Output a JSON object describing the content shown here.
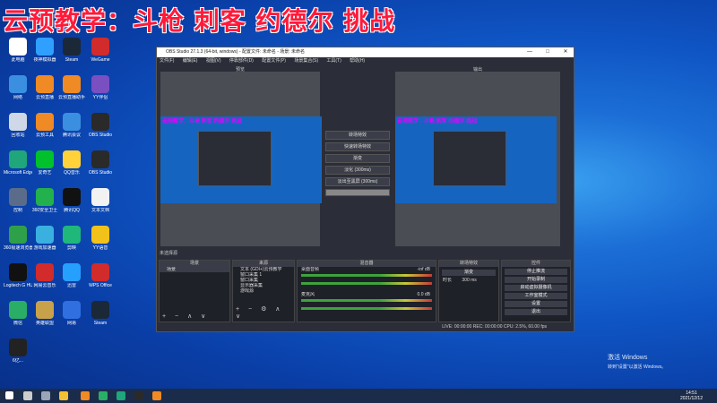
{
  "overlay": {
    "title": "云预教学：斗枪 刺客 约德尔 挑战"
  },
  "desktop_icons": [
    {
      "label": "此电脑",
      "color": "#ffffff"
    },
    {
      "label": "夜神模拟器",
      "color": "#2fa0ff"
    },
    {
      "label": "Steam",
      "color": "#1b2838"
    },
    {
      "label": "WeGame",
      "color": "#d12b2b"
    },
    {
      "label": "网络",
      "color": "#3a8fe0"
    },
    {
      "label": "云预直播",
      "color": "#f08a24"
    },
    {
      "label": "云预直播助手",
      "color": "#f08a24"
    },
    {
      "label": "YY伴侣",
      "color": "#7a4fc2"
    },
    {
      "label": "回收站",
      "color": "#cfd8e6"
    },
    {
      "label": "云预工具",
      "color": "#f08a24"
    },
    {
      "label": "腾讯会议",
      "color": "#3a8fe0"
    },
    {
      "label": "OBS Studio",
      "color": "#2a2a2a"
    },
    {
      "label": "Microsoft Edge",
      "color": "#1fa67a"
    },
    {
      "label": "爱奇艺",
      "color": "#00c12b"
    },
    {
      "label": "QQ音乐",
      "color": "#ffd23a"
    },
    {
      "label": "OBS Studio",
      "color": "#2a2a2a"
    },
    {
      "label": "控制",
      "color": "#5a6c8a"
    },
    {
      "label": "360安全卫士",
      "color": "#22b14c"
    },
    {
      "label": "腾讯QQ",
      "color": "#111111"
    },
    {
      "label": "文本文档",
      "color": "#f2f2f2"
    },
    {
      "label": "360极速浏览器",
      "color": "#2fa04a"
    },
    {
      "label": "游戏加速器",
      "color": "#3ab0e0"
    },
    {
      "label": "剪映",
      "color": "#1fb87a"
    },
    {
      "label": "YY语音",
      "color": "#f3c21a"
    },
    {
      "label": "Logitech G HUB",
      "color": "#111111"
    },
    {
      "label": "网易云音乐",
      "color": "#d12b2b"
    },
    {
      "label": "迅雷",
      "color": "#25a0ff"
    },
    {
      "label": "WPS Office",
      "color": "#d12b2b"
    },
    {
      "label": "微信",
      "color": "#2aae67"
    },
    {
      "label": "英雄联盟",
      "color": "#c8a24a"
    },
    {
      "label": "网易",
      "color": "#2f6fe0"
    },
    {
      "label": "Steam",
      "color": "#1b2838"
    },
    {
      "label": "6亿...",
      "color": "#222222"
    }
  ],
  "obs": {
    "title": "OBS Studio 27.1.3 (64-bit, windows) - 配置文件: 未命名 - 场景: 未命名",
    "window_controls": [
      "—",
      "□",
      "✕"
    ],
    "menu": [
      "文件(F)",
      "编辑(E)",
      "视图(V)",
      "停靠部件(D)",
      "配置文件(P)",
      "场景集合(S)",
      "工具(T)",
      "帮助(H)"
    ],
    "preview_label": "预览",
    "program_label": "输出",
    "screen_caption": "云预教学：斗枪 刺客 约德尔 挑战",
    "transition": {
      "buttons": [
        "转场特效",
        "快速转场特效",
        "渐变",
        "淡化 (300ms)",
        "淡出至黑屏 (300ms)"
      ]
    },
    "dock_bar": "未选择源",
    "scenes": {
      "header": "场景",
      "items": [
        "场景"
      ]
    },
    "sources": {
      "header": "来源",
      "items": [
        "文本 (GDI+)云预教学",
        "窗口采集 1",
        "窗口采集",
        "显示器采集",
        "游戏源"
      ]
    },
    "mixer": {
      "header": "混音器",
      "channels": [
        {
          "name": "桌面音频",
          "db": "-inf dB"
        },
        {
          "name": "麦克风",
          "db": "0.0 dB"
        }
      ]
    },
    "transitions_dock": {
      "header": "转场特效",
      "type": "渐变",
      "duration_label": "时长",
      "duration": "300 ms"
    },
    "controls": {
      "header": "控件",
      "buttons": [
        "停止推流",
        "开始录制",
        "启动虚拟摄像机",
        "工作室模式",
        "设置",
        "退出"
      ]
    },
    "status": "LIVE: 00:00:00   REC: 00:00:00   CPU: 2.5%, 60.00 fps"
  },
  "activation": {
    "line1": "激活 Windows",
    "line2": "转到\"设置\"以激活 Windows。"
  },
  "clock": {
    "time": "14:51",
    "date": "2021/12/12"
  }
}
